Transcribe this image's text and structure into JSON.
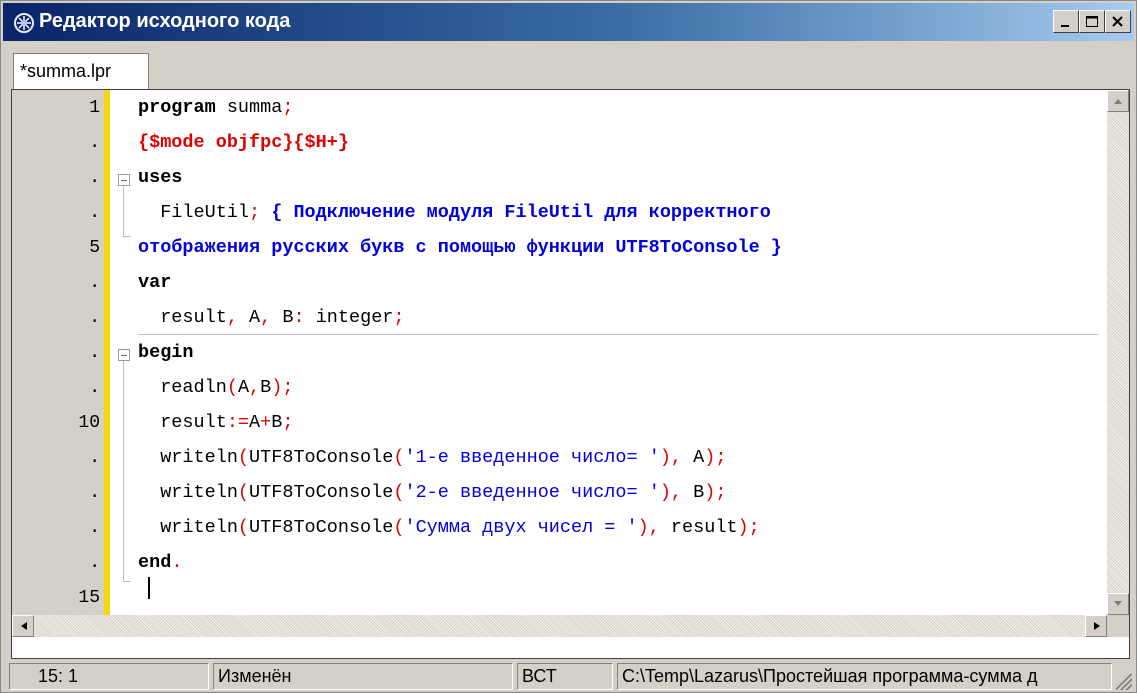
{
  "window": {
    "title": "Редактор исходного кода",
    "icon": "lazarus-app-icon"
  },
  "tabs": [
    {
      "label": "*summa.lpr",
      "active": true
    }
  ],
  "gutter": {
    "line_numbers": [
      "1",
      ".",
      ".",
      ".",
      "5",
      ".",
      ".",
      ".",
      ".",
      "10",
      ".",
      ".",
      ".",
      ".",
      "15"
    ]
  },
  "code": {
    "l1_kw": "program",
    "l1_rest": " summa",
    "l1_semi": ";",
    "l2_dir": "{$mode objfpc}{$H+}",
    "l3_kw": "uses",
    "l4_ident": "  FileUtil",
    "l4_semi": "; ",
    "l4_comment": "{ Подключение модуля FileUtil для корректного",
    "l5_comment": "отображения русских букв с помощью функции UTF8ToConsole }",
    "l6_kw": "var",
    "l7_a": "  result",
    "l7_b": ",",
    "l7_c": " A",
    "l7_d": ",",
    "l7_e": " B",
    "l7_f": ":",
    "l7_g": " integer",
    "l7_h": ";",
    "l8_kw": "begin",
    "l9_a": "  readln",
    "l9_b": "(",
    "l9_c": "A",
    "l9_d": ",",
    "l9_e": "B",
    "l9_f": ");",
    "l10_a": "  result",
    "l10_b": ":=",
    "l10_c": "A",
    "l10_d": "+",
    "l10_e": "B",
    "l10_f": ";",
    "l11_a": "  writeln",
    "l11_b": "(",
    "l11_c": "UTF8ToConsole",
    "l11_d": "(",
    "l11_e": "'1-е введенное число= '",
    "l11_f": "),",
    "l11_g": " A",
    "l11_h": ");",
    "l12_a": "  writeln",
    "l12_b": "(",
    "l12_c": "UTF8ToConsole",
    "l12_d": "(",
    "l12_e": "'2-е введенное число= '",
    "l12_f": "),",
    "l12_g": " B",
    "l12_h": ");",
    "l13_a": "  writeln",
    "l13_b": "(",
    "l13_c": "UTF8ToConsole",
    "l13_d": "(",
    "l13_e": "'Сумма двух чисел = '",
    "l13_f": "),",
    "l13_g": " result",
    "l13_h": ");",
    "l14_kw": "end",
    "l14_dot": "."
  },
  "statusbar": {
    "position": "15:  1",
    "state": "Изменён",
    "mode": "ВСТ",
    "path": "C:\\Temp\\Lazarus\\Простейшая программа-сумма д"
  },
  "colors": {
    "keyword": "#000000",
    "symbol": "#e00000",
    "comment": "#0000e0",
    "string": "#0000e0",
    "changebar": "#f6d80a",
    "titlebar": "#0a246a"
  }
}
